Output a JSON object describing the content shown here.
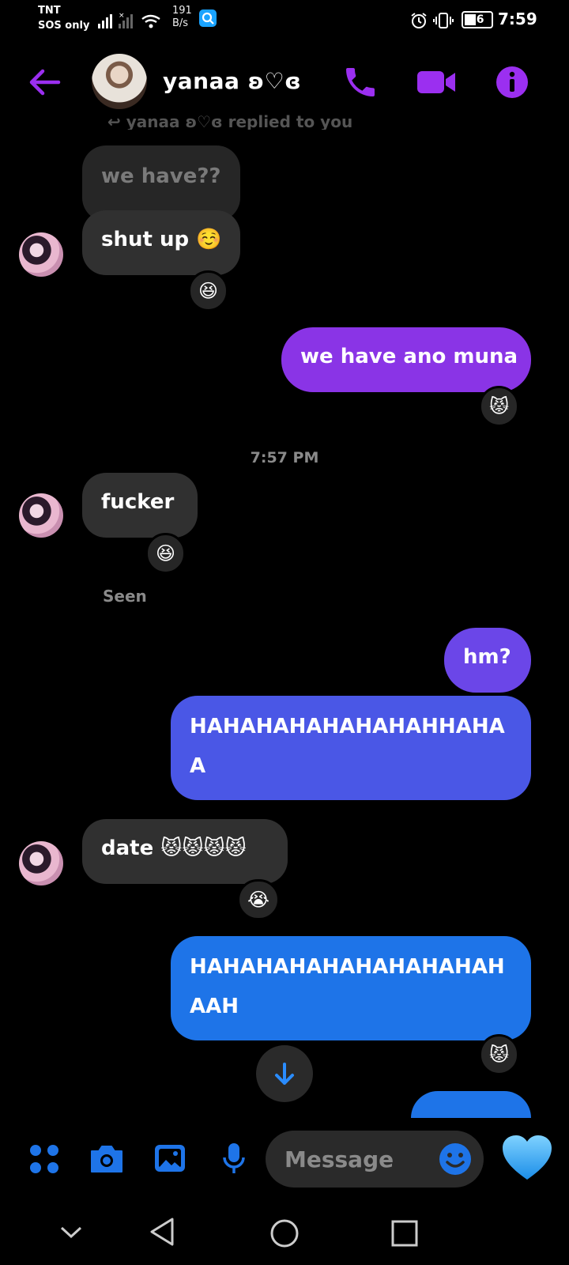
{
  "status_bar": {
    "carrier": "TNT",
    "carrier_status": "SOS only",
    "net_speed_value": "191",
    "net_speed_unit": "B/s",
    "battery": "36",
    "time": "7:59"
  },
  "header": {
    "contact_name": "yanaa ʚ♡ɞ"
  },
  "colors": {
    "accent_purple": "#8a34e6",
    "accent_blue": "#1e74e8",
    "incoming_bubble": "#303030"
  },
  "messages": {
    "reply_hint": "↩ yanaa ʚ♡ɞ replied to you",
    "quoted": "we have??",
    "m1": "shut up ☺️",
    "m1_reaction": "😆",
    "m2": "we have ano muna",
    "m2_reaction": "😾",
    "timestamp": "7:57 PM",
    "m3": "fucker",
    "m3_reaction": "😆",
    "seen": "Seen",
    "m4": "hm?",
    "m5_line1": "HAHAHAHAHAHAHAHHAHA",
    "m5_line2": "A",
    "m6": "date 😾😾😾😾",
    "m6_reaction": "😭",
    "m7_line1": "HAHAHAHAHAHAHAHAHAH",
    "m7_line2": "AAH",
    "m7_reaction": "😾"
  },
  "composer": {
    "placeholder": "Message"
  },
  "icons": [
    "back-arrow-icon",
    "phone-icon",
    "video-camera-icon",
    "info-icon",
    "apps-grid-icon",
    "camera-icon",
    "gallery-icon",
    "microphone-icon",
    "emoji-icon",
    "heart-icon",
    "arrow-down-icon"
  ]
}
